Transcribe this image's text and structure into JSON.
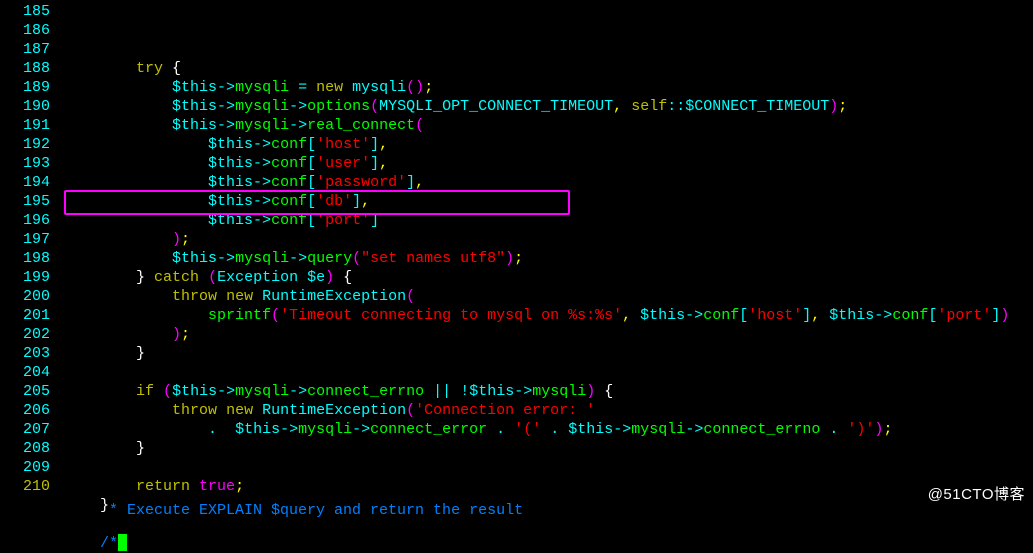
{
  "watermark": "@51CTO博客",
  "line_start": 185,
  "lines": [
    {
      "n": 185,
      "segs": [
        [
          "plain",
          "        "
        ],
        [
          "kw",
          "try"
        ],
        [
          "plain",
          " "
        ],
        [
          "brace",
          "{"
        ]
      ]
    },
    {
      "n": 186,
      "segs": [
        [
          "plain",
          "            "
        ],
        [
          "var",
          "$this"
        ],
        [
          "op",
          "->"
        ],
        [
          "prop",
          "mysqli"
        ],
        [
          "plain",
          " "
        ],
        [
          "op",
          "="
        ],
        [
          "plain",
          " "
        ],
        [
          "kw",
          "new"
        ],
        [
          "plain",
          " "
        ],
        [
          "cls",
          "mysqli"
        ],
        [
          "paren",
          "()"
        ],
        [
          "punc",
          ";"
        ]
      ]
    },
    {
      "n": 187,
      "segs": [
        [
          "plain",
          "            "
        ],
        [
          "var",
          "$this"
        ],
        [
          "op",
          "->"
        ],
        [
          "prop",
          "mysqli"
        ],
        [
          "op",
          "->"
        ],
        [
          "fn",
          "options"
        ],
        [
          "paren",
          "("
        ],
        [
          "const",
          "MYSQLI_OPT_CONNECT_TIMEOUT"
        ],
        [
          "punc",
          ","
        ],
        [
          "plain",
          " "
        ],
        [
          "kw",
          "self"
        ],
        [
          "op",
          "::"
        ],
        [
          "const",
          "$CONNECT_TIMEOUT"
        ],
        [
          "paren",
          ")"
        ],
        [
          "punc",
          ";"
        ]
      ]
    },
    {
      "n": 188,
      "segs": [
        [
          "plain",
          "            "
        ],
        [
          "var",
          "$this"
        ],
        [
          "op",
          "->"
        ],
        [
          "prop",
          "mysqli"
        ],
        [
          "op",
          "->"
        ],
        [
          "fn",
          "real_connect"
        ],
        [
          "paren",
          "("
        ]
      ]
    },
    {
      "n": 189,
      "segs": [
        [
          "plain",
          "                "
        ],
        [
          "var",
          "$this"
        ],
        [
          "op",
          "->"
        ],
        [
          "prop",
          "conf"
        ],
        [
          "brack",
          "["
        ],
        [
          "str",
          "'host'"
        ],
        [
          "brack",
          "]"
        ],
        [
          "punc",
          ","
        ]
      ]
    },
    {
      "n": 190,
      "segs": [
        [
          "plain",
          "                "
        ],
        [
          "var",
          "$this"
        ],
        [
          "op",
          "->"
        ],
        [
          "prop",
          "conf"
        ],
        [
          "brack",
          "["
        ],
        [
          "str",
          "'user'"
        ],
        [
          "brack",
          "]"
        ],
        [
          "punc",
          ","
        ]
      ]
    },
    {
      "n": 191,
      "segs": [
        [
          "plain",
          "                "
        ],
        [
          "var",
          "$this"
        ],
        [
          "op",
          "->"
        ],
        [
          "prop",
          "conf"
        ],
        [
          "brack",
          "["
        ],
        [
          "str",
          "'password'"
        ],
        [
          "brack",
          "]"
        ],
        [
          "punc",
          ","
        ]
      ]
    },
    {
      "n": 192,
      "segs": [
        [
          "plain",
          "                "
        ],
        [
          "var",
          "$this"
        ],
        [
          "op",
          "->"
        ],
        [
          "prop",
          "conf"
        ],
        [
          "brack",
          "["
        ],
        [
          "str",
          "'db'"
        ],
        [
          "brack",
          "]"
        ],
        [
          "punc",
          ","
        ]
      ]
    },
    {
      "n": 193,
      "segs": [
        [
          "plain",
          "                "
        ],
        [
          "var",
          "$this"
        ],
        [
          "op",
          "->"
        ],
        [
          "prop",
          "conf"
        ],
        [
          "brack",
          "["
        ],
        [
          "str",
          "'port'"
        ],
        [
          "brack",
          "]"
        ]
      ]
    },
    {
      "n": 194,
      "segs": [
        [
          "plain",
          "            "
        ],
        [
          "paren",
          ")"
        ],
        [
          "punc",
          ";"
        ]
      ]
    },
    {
      "n": 195,
      "segs": [
        [
          "plain",
          "            "
        ],
        [
          "var",
          "$this"
        ],
        [
          "op",
          "->"
        ],
        [
          "prop",
          "mysqli"
        ],
        [
          "op",
          "->"
        ],
        [
          "fn",
          "query"
        ],
        [
          "paren",
          "("
        ],
        [
          "str",
          "\"set names utf8\""
        ],
        [
          "paren",
          ")"
        ],
        [
          "punc",
          ";"
        ]
      ]
    },
    {
      "n": 196,
      "segs": [
        [
          "plain",
          "        "
        ],
        [
          "brace",
          "}"
        ],
        [
          "plain",
          " "
        ],
        [
          "kw",
          "catch"
        ],
        [
          "plain",
          " "
        ],
        [
          "paren",
          "("
        ],
        [
          "cls",
          "Exception"
        ],
        [
          "plain",
          " "
        ],
        [
          "var",
          "$e"
        ],
        [
          "paren",
          ")"
        ],
        [
          "plain",
          " "
        ],
        [
          "brace",
          "{"
        ]
      ]
    },
    {
      "n": 197,
      "segs": [
        [
          "plain",
          "            "
        ],
        [
          "kw",
          "throw"
        ],
        [
          "plain",
          " "
        ],
        [
          "kw",
          "new"
        ],
        [
          "plain",
          " "
        ],
        [
          "cls",
          "RuntimeException"
        ],
        [
          "paren",
          "("
        ]
      ]
    },
    {
      "n": 198,
      "segs": [
        [
          "plain",
          "                "
        ],
        [
          "fn",
          "sprintf"
        ],
        [
          "paren",
          "("
        ],
        [
          "str",
          "'Timeout connecting to mysql on %s:%s'"
        ],
        [
          "punc",
          ","
        ],
        [
          "plain",
          " "
        ],
        [
          "var",
          "$this"
        ],
        [
          "op",
          "->"
        ],
        [
          "prop",
          "conf"
        ],
        [
          "brack",
          "["
        ],
        [
          "str",
          "'host'"
        ],
        [
          "brack",
          "]"
        ],
        [
          "punc",
          ","
        ],
        [
          "plain",
          " "
        ],
        [
          "var",
          "$this"
        ],
        [
          "op",
          "->"
        ],
        [
          "prop",
          "conf"
        ],
        [
          "brack",
          "["
        ],
        [
          "str",
          "'port'"
        ],
        [
          "brack",
          "]"
        ],
        [
          "paren",
          ")"
        ]
      ]
    },
    {
      "n": 199,
      "segs": [
        [
          "plain",
          "            "
        ],
        [
          "paren",
          ")"
        ],
        [
          "punc",
          ";"
        ]
      ]
    },
    {
      "n": 200,
      "segs": [
        [
          "plain",
          "        "
        ],
        [
          "brace",
          "}"
        ]
      ]
    },
    {
      "n": 201,
      "segs": []
    },
    {
      "n": 202,
      "segs": [
        [
          "plain",
          "        "
        ],
        [
          "kw",
          "if"
        ],
        [
          "plain",
          " "
        ],
        [
          "paren",
          "("
        ],
        [
          "var",
          "$this"
        ],
        [
          "op",
          "->"
        ],
        [
          "prop",
          "mysqli"
        ],
        [
          "op",
          "->"
        ],
        [
          "prop",
          "connect_errno"
        ],
        [
          "plain",
          " "
        ],
        [
          "op",
          "||"
        ],
        [
          "plain",
          " "
        ],
        [
          "op",
          "!"
        ],
        [
          "var",
          "$this"
        ],
        [
          "op",
          "->"
        ],
        [
          "prop",
          "mysqli"
        ],
        [
          "paren",
          ")"
        ],
        [
          "plain",
          " "
        ],
        [
          "brace",
          "{"
        ]
      ]
    },
    {
      "n": 203,
      "segs": [
        [
          "plain",
          "            "
        ],
        [
          "kw",
          "throw"
        ],
        [
          "plain",
          " "
        ],
        [
          "kw",
          "new"
        ],
        [
          "plain",
          " "
        ],
        [
          "cls",
          "RuntimeException"
        ],
        [
          "paren",
          "("
        ],
        [
          "str",
          "'Connection error: '"
        ]
      ]
    },
    {
      "n": 204,
      "segs": [
        [
          "plain",
          "                "
        ],
        [
          "op",
          "."
        ],
        [
          "plain",
          "  "
        ],
        [
          "var",
          "$this"
        ],
        [
          "op",
          "->"
        ],
        [
          "prop",
          "mysqli"
        ],
        [
          "op",
          "->"
        ],
        [
          "prop",
          "connect_error"
        ],
        [
          "plain",
          " "
        ],
        [
          "op",
          "."
        ],
        [
          "plain",
          " "
        ],
        [
          "str",
          "'('"
        ],
        [
          "plain",
          " "
        ],
        [
          "op",
          "."
        ],
        [
          "plain",
          " "
        ],
        [
          "var",
          "$this"
        ],
        [
          "op",
          "->"
        ],
        [
          "prop",
          "mysqli"
        ],
        [
          "op",
          "->"
        ],
        [
          "prop",
          "connect_errno"
        ],
        [
          "plain",
          " "
        ],
        [
          "op",
          "."
        ],
        [
          "plain",
          " "
        ],
        [
          "str",
          "')'"
        ],
        [
          "paren",
          ")"
        ],
        [
          "punc",
          ";"
        ]
      ]
    },
    {
      "n": 205,
      "segs": [
        [
          "plain",
          "        "
        ],
        [
          "brace",
          "}"
        ]
      ]
    },
    {
      "n": 206,
      "segs": []
    },
    {
      "n": 207,
      "segs": [
        [
          "plain",
          "        "
        ],
        [
          "kw",
          "return"
        ],
        [
          "plain",
          " "
        ],
        [
          "bool",
          "true"
        ],
        [
          "punc",
          ";"
        ]
      ]
    },
    {
      "n": 208,
      "segs": [
        [
          "plain",
          "    "
        ],
        [
          "brace",
          "}"
        ]
      ]
    },
    {
      "n": 209,
      "segs": []
    },
    {
      "n": 210,
      "segs": [
        [
          "plain",
          "    "
        ],
        [
          "cmt",
          "/*"
        ],
        [
          "cursor",
          ""
        ]
      ]
    }
  ],
  "cutoff_comment": "     * Execute EXPLAIN $query and return the result"
}
